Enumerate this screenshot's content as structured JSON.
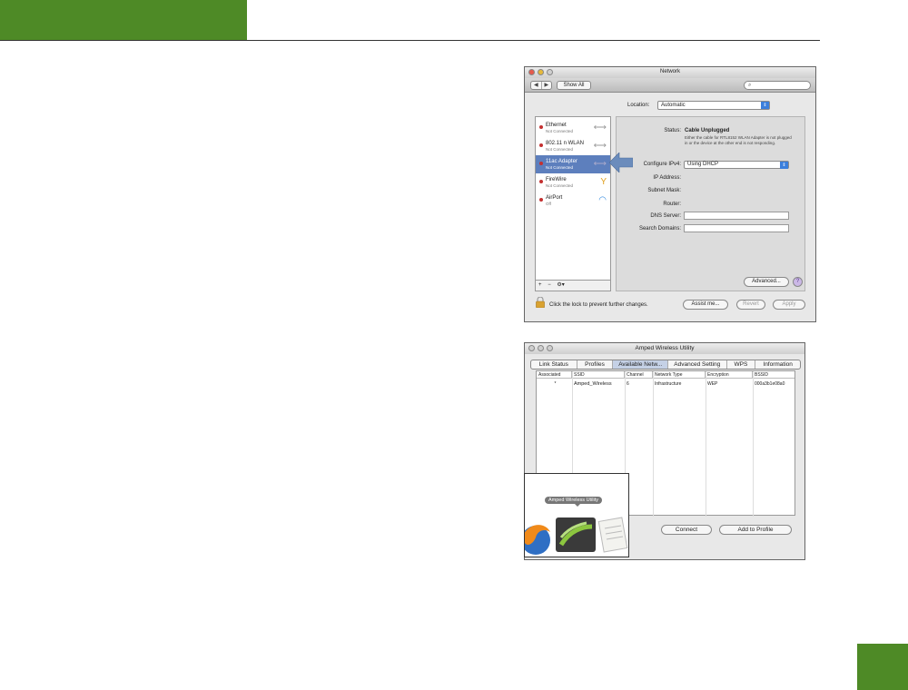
{
  "network": {
    "title": "Network",
    "show_all": "Show All",
    "location_label": "Location:",
    "location_value": "Automatic",
    "services": [
      {
        "name": "Ethernet",
        "status": "Not Connected",
        "icon": "ethernet-icon"
      },
      {
        "name": "802.11 n WLAN",
        "status": "Not Connected",
        "icon": "ethernet-icon"
      },
      {
        "name": "11ac Adapter",
        "status": "Not Connected",
        "icon": "ethernet-icon"
      },
      {
        "name": "FireWire",
        "status": "Not Connected",
        "icon": "firewire-icon"
      },
      {
        "name": "AirPort",
        "status": "Off",
        "icon": "wifi-icon"
      }
    ],
    "status_label": "Status:",
    "status_value": "Cable Unplugged",
    "status_note": "Either the cable for RTL8152 WLAN Adapter is not plugged in or the device at the other end is not responding.",
    "configure_label": "Configure IPv4:",
    "configure_value": "Using DHCP",
    "ip_label": "IP Address:",
    "subnet_label": "Subnet Mask:",
    "router_label": "Router:",
    "dns_label": "DNS Server:",
    "search_domains_label": "Search Domains:",
    "advanced": "Advanced...",
    "help": "?",
    "lock_text": "Click the lock to prevent further changes.",
    "assist": "Assist me...",
    "revert": "Revert",
    "apply": "Apply",
    "list_controls": [
      "+",
      "−",
      "⚙▾"
    ]
  },
  "amped": {
    "title": "Amped Wireless Utility",
    "tabs": [
      "Link Status",
      "Profiles",
      "Available Netw...",
      "Advanced Setting",
      "WPS",
      "Information"
    ],
    "active_tab": 2,
    "columns": [
      "Associated",
      "SSID",
      "Channel",
      "Network Type",
      "Encryption",
      "BSSID"
    ],
    "rows": [
      {
        "associated": "*",
        "ssid": "Amped_Wireless",
        "channel": "6",
        "type": "Infrastructure",
        "encryption": "WEP",
        "bssid": "000a3b1e08a0"
      }
    ],
    "buttons": [
      "Connect",
      "Add to Profile"
    ]
  },
  "dock": {
    "label": "Amped Wireless Utility"
  },
  "colors": {
    "brand_green": "#4e8a26",
    "selection_blue": "#5d7fbd",
    "callout_arrow": "#6b8cbc"
  }
}
